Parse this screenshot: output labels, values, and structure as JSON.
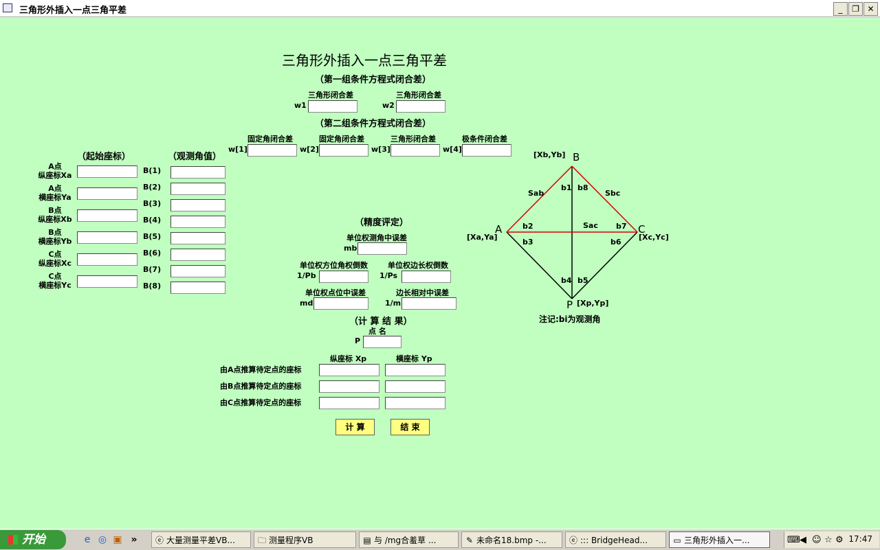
{
  "window": {
    "title": "三角形外插入一点三角平差",
    "min_icon": "minimize-icon",
    "max_icon": "restore-icon",
    "close_icon": "close-icon"
  },
  "form": {
    "heading": "三角形外插入一点三角平差",
    "group1": "（第一组条件方程式闭合差）",
    "tri_closure1": "三角形闭合差",
    "tri_closure2": "三角形闭合差",
    "w1": "w1",
    "w2": "w2",
    "group2": "（第二组条件方程式闭合差）",
    "fixed_angle1": "固定角闭合差",
    "fixed_angle2": "固定角闭合差",
    "tri_closure3": "三角形闭合差",
    "pole_closure": "极条件闭合差",
    "w_1": "w[1]",
    "w_2": "w[2]",
    "w_3": "w[3]",
    "w_4": "w[4]",
    "start_coords": "（起始座标）",
    "observed": "（观测角值）",
    "coord_labels": [
      {
        "top": "A点",
        "bottom": "纵座标Xa"
      },
      {
        "top": "A点",
        "bottom": "横座标Ya"
      },
      {
        "top": "B点",
        "bottom": "纵座标Xb"
      },
      {
        "top": "B点",
        "bottom": "横座标Yb"
      },
      {
        "top": "C点",
        "bottom": "纵座标Xc"
      },
      {
        "top": "C点",
        "bottom": "横座标Yc"
      }
    ],
    "angle_labels": [
      "B(1)",
      "B(2)",
      "B(3)",
      "B(4)",
      "B(5)",
      "B(6)",
      "B(7)",
      "B(8)"
    ],
    "precision": "（精度评定）",
    "unit_angle_err": "单位权测角中误差",
    "mb": "mb",
    "unit_bearing": "单位权方位角权倒数",
    "unit_side": "单位权边长权倒数",
    "pb": "1/Pb",
    "ps": "1/Ps",
    "unit_point_err": "单位权点位中误差",
    "side_rel_err": "边长相对中误差",
    "md": "md",
    "m": "1/m",
    "results": "（计 算 结 果）",
    "point_name": "点 名",
    "p": "P",
    "xp_header": "纵座标 Xp",
    "yp_header": "横座标 Yp",
    "from_a": "由A点推算待定点的座标",
    "from_b": "由B点推算待定点的座标",
    "from_c": "由C点推算待定点的座标",
    "calc_button": "计 算",
    "end_button": "结 束"
  },
  "diagram": {
    "pt_a": "A",
    "pt_b": "B",
    "pt_c": "C",
    "pt_p": "P",
    "xa_ya": "[Xa,Ya]",
    "xb_yb": "[Xb,Yb]",
    "xc_yc": "[Xc,Yc]",
    "xp_yp": "[Xp,Yp]",
    "sab": "Sab",
    "sbc": "Sbc",
    "sac": "Sac",
    "b1": "b1",
    "b2": "b2",
    "b3": "b3",
    "b4": "b4",
    "b5": "b5",
    "b6": "b6",
    "b7": "b7",
    "b8": "b8",
    "note": "注记:bi为观测角",
    "red_color": "#d40000"
  },
  "taskbar": {
    "start": "开始",
    "quick_icons": [
      "ie-icon",
      "browser-icon",
      "app-icon"
    ],
    "more": "»",
    "tasks": [
      {
        "label": "大量测量平差VB...",
        "icon": "ie-icon"
      },
      {
        "label": "测量程序VB",
        "icon": "folder-icon"
      },
      {
        "label": "与 /mg合羞草 ...",
        "icon": "chat-icon"
      },
      {
        "label": "未命名18.bmp -...",
        "icon": "paint-icon"
      },
      {
        "label": "::: BridgeHead...",
        "icon": "ie-icon"
      },
      {
        "label": "三角形外插入一...",
        "icon": "window-icon"
      }
    ],
    "clock": "17:47"
  }
}
